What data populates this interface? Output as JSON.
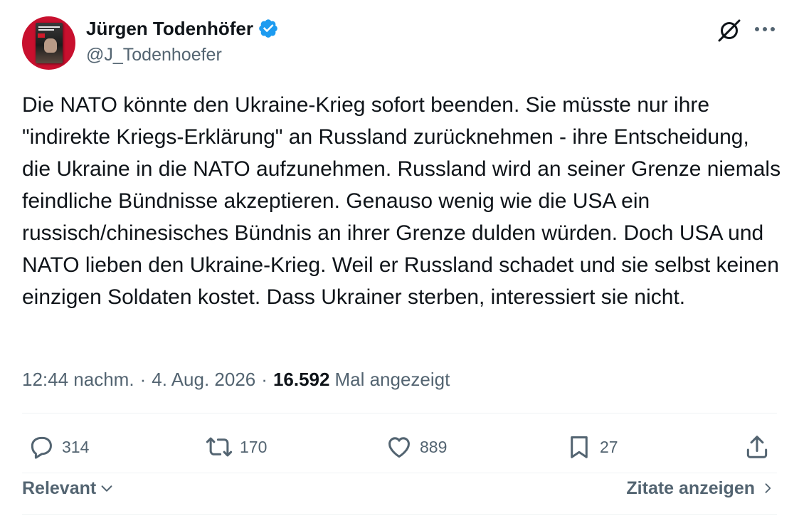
{
  "author": {
    "display_name": "Jürgen Todenhöfer",
    "handle": "@J_Todenhoefer",
    "verified": true,
    "avatar_icon": "book-cover-avatar"
  },
  "tweet": {
    "text": "Die NATO könnte den Ukraine-Krieg sofort beenden. Sie müsste nur ihre \"indirekte Kriegs-Erklärung\" an Russland zurücknehmen - ihre Entscheidung, die Ukraine in die NATO aufzunehmen. Russland wird an seiner Grenze niemals feindliche Bündnisse akzeptieren. Genauso wenig wie die USA ein russisch/chinesisches Bündnis an ihrer Grenze dulden würden. Doch USA und NATO lieben den Ukraine-Krieg. Weil er Russland schadet und sie selbst keinen einzigen Soldaten kostet. Dass Ukrainer sterben, interessiert sie nicht.",
    "time": "12:44 nachm.",
    "date": "4. Aug. 2026",
    "separator": "·",
    "views_count": "16.592",
    "views_label": "Mal angezeigt"
  },
  "actions": {
    "replies": "314",
    "reposts": "170",
    "likes": "889",
    "bookmarks": "27"
  },
  "footer": {
    "sort_label": "Relevant",
    "quotes_label": "Zitate anzeigen"
  },
  "colors": {
    "text_primary": "#0f1419",
    "text_secondary": "#536471",
    "verified_blue": "#1d9bf0",
    "divider": "#eff3f4"
  }
}
